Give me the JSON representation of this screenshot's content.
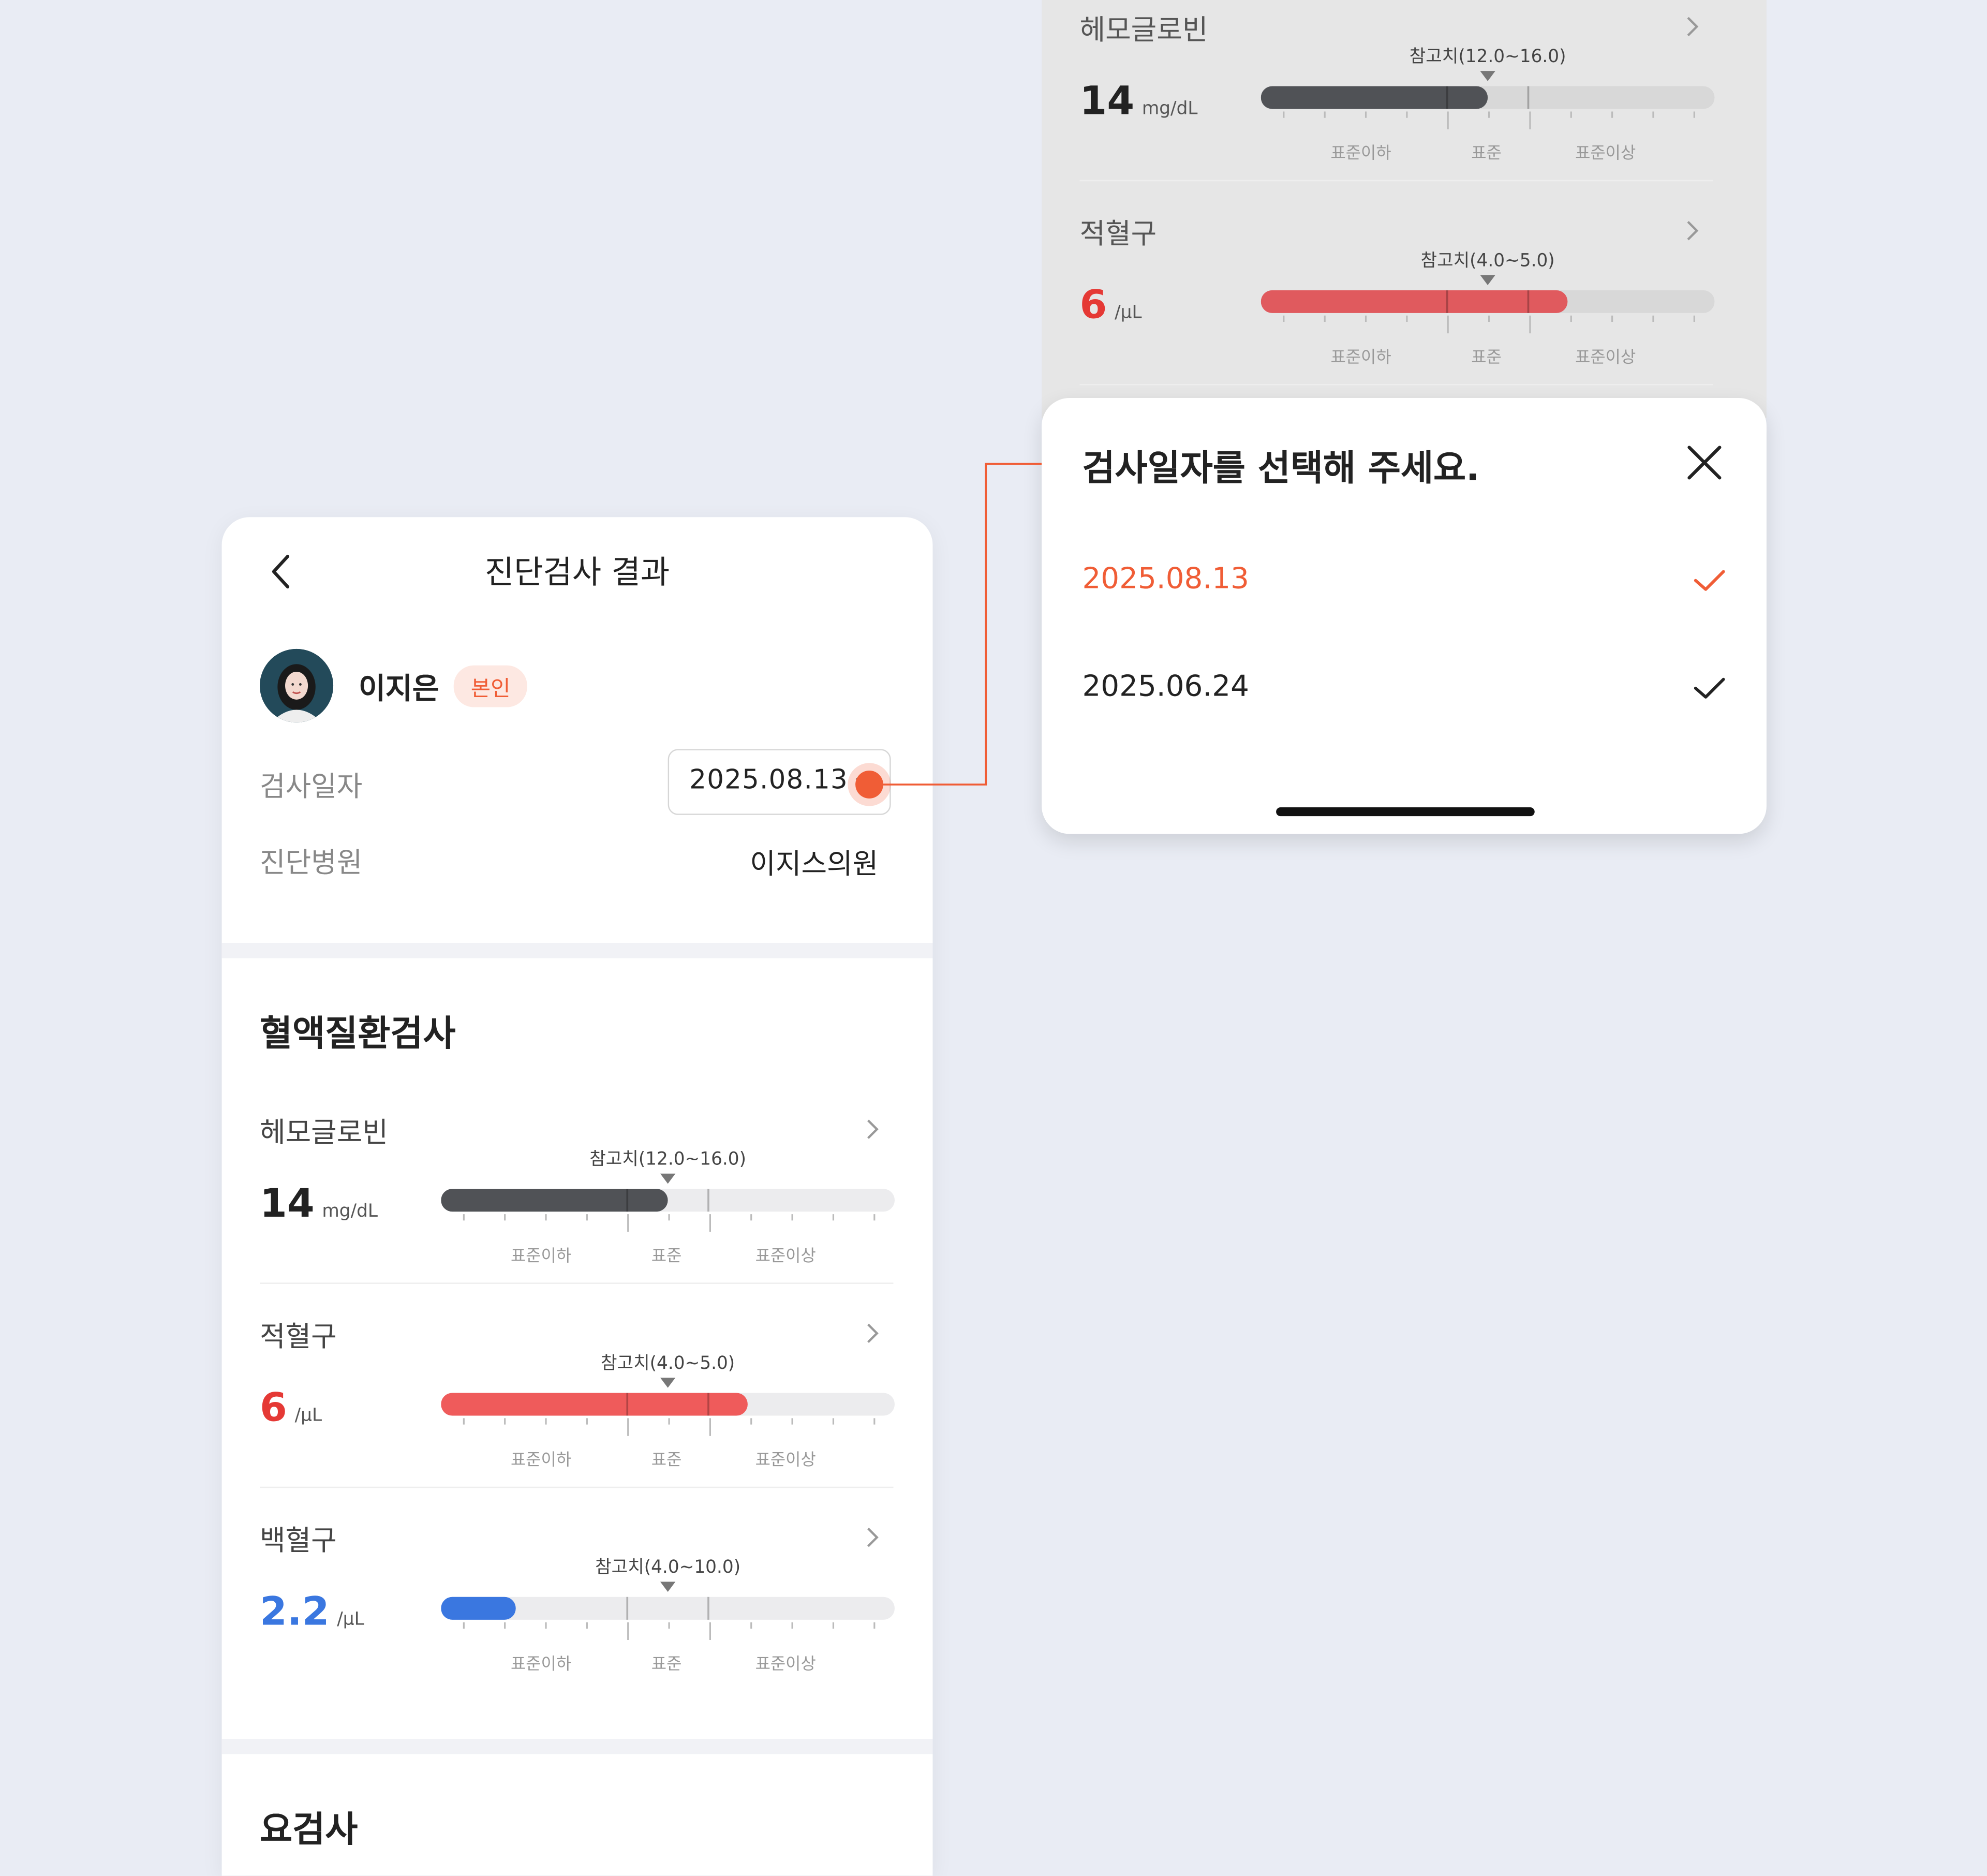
{
  "colors": {
    "accent": "#f05d36",
    "gray_bar": "#505256",
    "red_bar": "#ef5b5b",
    "blue_bar": "#3a77e0",
    "track": "#ececee"
  },
  "left": {
    "header": {
      "title": "진단검사 결과",
      "back_icon": "chevron-left-icon"
    },
    "profile": {
      "name": "이지은",
      "badge": "본인"
    },
    "exam_date": {
      "label": "검사일자",
      "value": "2025.08.13"
    },
    "hospital": {
      "label": "진단병원",
      "value": "이지스의원"
    },
    "section1": {
      "title": "혈액질환검사",
      "items": [
        {
          "name": "헤모글로빈",
          "value": "14",
          "unit": "mg/dL",
          "ref": "참고치(12.0~16.0)",
          "fill": 0.5,
          "color": "#505256",
          "value_color": "#222222",
          "low": "표준이하",
          "normal": "표준",
          "high": "표준이상"
        },
        {
          "name": "적혈구",
          "value": "6",
          "unit": "/μL",
          "ref": "참고치(4.0~5.0)",
          "fill": 0.675,
          "color": "#ef5b5b",
          "value_color": "#e53935",
          "low": "표준이하",
          "normal": "표준",
          "high": "표준이상"
        },
        {
          "name": "백혈구",
          "value": "2.2",
          "unit": "/μL",
          "ref": "참고치(4.0~10.0)",
          "fill": 0.165,
          "color": "#3a77e0",
          "value_color": "#3a77e0",
          "low": "표준이하",
          "normal": "표준",
          "high": "표준이상"
        }
      ]
    },
    "section2": {
      "title": "요검사"
    }
  },
  "right": {
    "items": [
      {
        "name": "헤모글로빈",
        "value": "14",
        "unit": "mg/dL",
        "ref": "참고치(12.0~16.0)",
        "fill": 0.5,
        "color": "#505256",
        "value_color": "#222222",
        "low": "표준이하",
        "normal": "표준",
        "high": "표준이상"
      },
      {
        "name": "적혈구",
        "value": "6",
        "unit": "/μL",
        "ref": "참고치(4.0~5.0)",
        "fill": 0.675,
        "color": "#e05a5e",
        "value_color": "#e53935",
        "low": "표준이하",
        "normal": "표준",
        "high": "표준이상"
      }
    ],
    "sheet": {
      "title": "검사일자를 선택해 주세요.",
      "close_icon": "close-icon",
      "options": [
        {
          "label": "2025.08.13",
          "selected": true
        },
        {
          "label": "2025.06.24",
          "selected": false
        }
      ]
    }
  }
}
